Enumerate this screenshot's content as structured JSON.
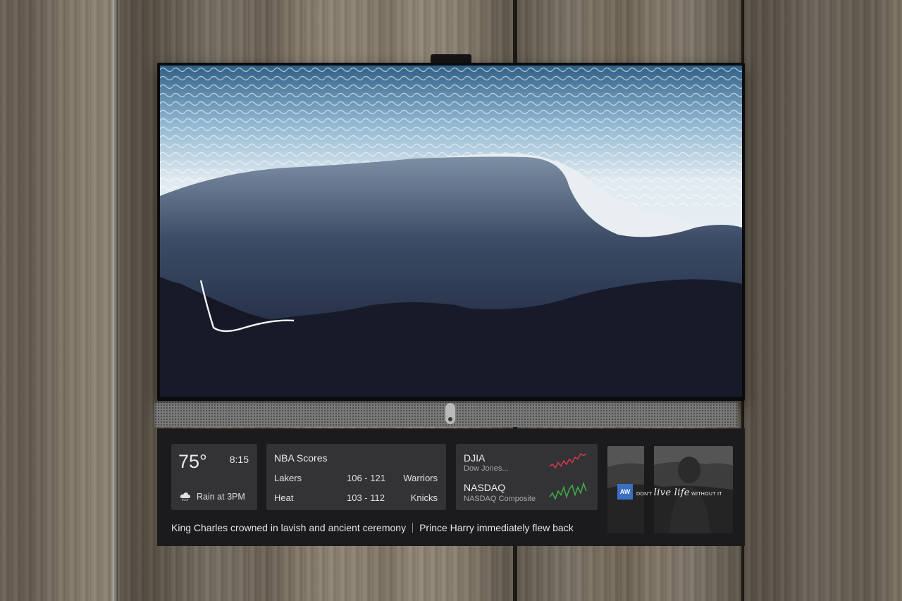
{
  "weather": {
    "temperature": "75°",
    "time": "8:15",
    "forecast": "Rain at 3PM",
    "icon": "cloud-rain-icon"
  },
  "nba": {
    "title": "NBA Scores",
    "games": [
      {
        "team_a": "Lakers",
        "score": "106 - 121",
        "team_b": "Warriors"
      },
      {
        "team_a": "Heat",
        "score": "103 - 112",
        "team_b": "Knicks"
      }
    ]
  },
  "stocks": [
    {
      "name": "DJIA",
      "subtitle": "Dow Jones...",
      "trend_color": "#d8384a",
      "trend": [
        5,
        6,
        4,
        7,
        5,
        8,
        6,
        9,
        7,
        10,
        9,
        12,
        11,
        12
      ]
    },
    {
      "name": "NASDAQ",
      "subtitle": "NASDAQ Composite",
      "trend_color": "#3fae49",
      "trend": [
        7,
        9,
        6,
        10,
        8,
        12,
        7,
        11,
        13,
        8,
        12,
        9,
        14,
        10
      ]
    }
  ],
  "ad": {
    "logo": "AW",
    "tagline_prefix": "DON'T",
    "tagline_script": "live life",
    "tagline_suffix": "WITHOUT IT"
  },
  "ticker": {
    "headlines": [
      "King Charles crowned in lavish and ancient ceremony",
      "Prince Harry immediately flew back"
    ]
  }
}
